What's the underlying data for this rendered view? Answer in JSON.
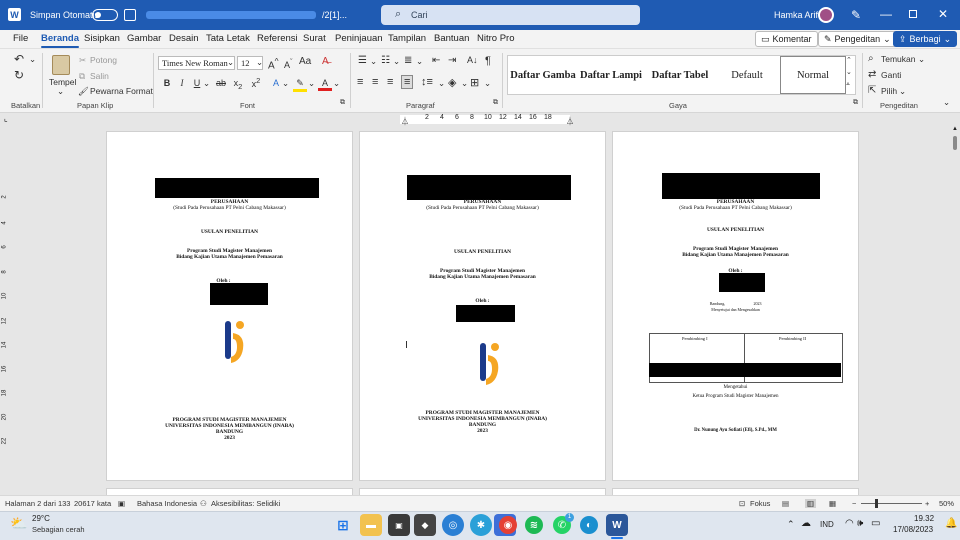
{
  "titlebar": {
    "autosave_label": "Simpan Otomatis",
    "doc_title_suffix": "/2[1]...",
    "search_placeholder": "Cari",
    "user_name": "Hamka Arif"
  },
  "menu": {
    "tabs": [
      "File",
      "Beranda",
      "Sisipkan",
      "Gambar",
      "Desain",
      "Tata Letak",
      "Referensi",
      "Surat",
      "Peninjauan",
      "Tampilan",
      "Bantuan",
      "Nitro Pro"
    ],
    "active": "Beranda",
    "comment_btn": "Komentar",
    "edit_btn": "Pengeditan",
    "share_btn": "Berbagi"
  },
  "ribbon": {
    "undo_group": "Batalkan",
    "clipboard": {
      "paste": "Tempel",
      "cut": "Potong",
      "copy": "Salin",
      "format_painter": "Pewarna Format",
      "label": "Papan Klip"
    },
    "font": {
      "name": "Times New Roman",
      "size": "12",
      "label": "Font"
    },
    "paragraph_label": "Paragraf",
    "styles": [
      "Daftar Gamba",
      "Daftar Lampi",
      "Daftar Tabel",
      "Default",
      "Normal"
    ],
    "styles_label": "Gaya",
    "editing": {
      "find": "Temukan",
      "replace": "Ganti",
      "select": "Pilih",
      "label": "Pengeditan"
    }
  },
  "ruler": {
    "h_ticks": [
      "2",
      "4",
      "6",
      "8",
      "10",
      "12",
      "14",
      "16",
      "18"
    ],
    "v_ticks": [
      "2",
      "4",
      "6",
      "8",
      "10",
      "12",
      "14",
      "16",
      "18",
      "20",
      "22"
    ]
  },
  "pages": {
    "p1": {
      "company": "PERUSAHAAN",
      "study": "(Studi Pada Perusahaan PT Pelni Cabang Makassar)",
      "heading": "USULAN PENELITIAN",
      "program1": "Program Studi Magister Manajemen",
      "program2": "Bidang Kajian Utama Manajemen Pemasaran",
      "by": "Oleh :",
      "footer1": "PROGRAM STUDI MAGISTER MANAJEMEN",
      "footer2": "UNIVERSITAS INDONESIA MEMBANGUN (INABA)",
      "footer3": "BANDUNG",
      "footer4": "2023"
    },
    "p2": {
      "company": "PERUSAHAAN",
      "study": "(Studi Pada Perusahaan PT Pelni Cabang Makassar)",
      "heading": "USULAN PENELITIAN",
      "program1": "Program Studi Magister Manajemen",
      "program2": "Bidang Kajian Utama Manajemen Pemasaran",
      "by": "Oleh :",
      "footer1": "PROGRAM STUDI MAGISTER MANAJEMEN",
      "footer2": "UNIVERSITAS INDONESIA MEMBANGUN (INABA)",
      "footer3": "BANDUNG",
      "footer4": "2023"
    },
    "p3": {
      "company": "PERUSAHAAN",
      "study": "(Studi Pada Perusahaan PT Pelni Cabang Makassar)",
      "heading": "USULAN PENELITIAN",
      "program1": "Program Studi Magister Manajemen",
      "program2": "Bidang Kajian Utama Manajemen Pemasaran",
      "by": "Oleh :",
      "city_date": "Bandung,",
      "year": "2023",
      "approve": "Menyetujui dan Mengesahkan",
      "advisor1": "Pembimbing I",
      "advisor2": "Pembimbing II",
      "know": "Mengetahui",
      "chair": "Ketua Program Studi Magister Manajemen",
      "chair_name": "Dr. Nunung Ayu Sofiati (Efi), S.Pd., MM"
    }
  },
  "status": {
    "page": "Halaman 2 dari 133",
    "words": "20617 kata",
    "lang": "Bahasa Indonesia",
    "access": "Aksesibilitas: Selidiki",
    "focus": "Fokus",
    "zoom": "50%"
  },
  "taskbar": {
    "temp": "29°C",
    "weather": "Sebagian cerah",
    "lang": "IND",
    "time": "19.32",
    "date": "17/08/2023",
    "badge": "1"
  }
}
